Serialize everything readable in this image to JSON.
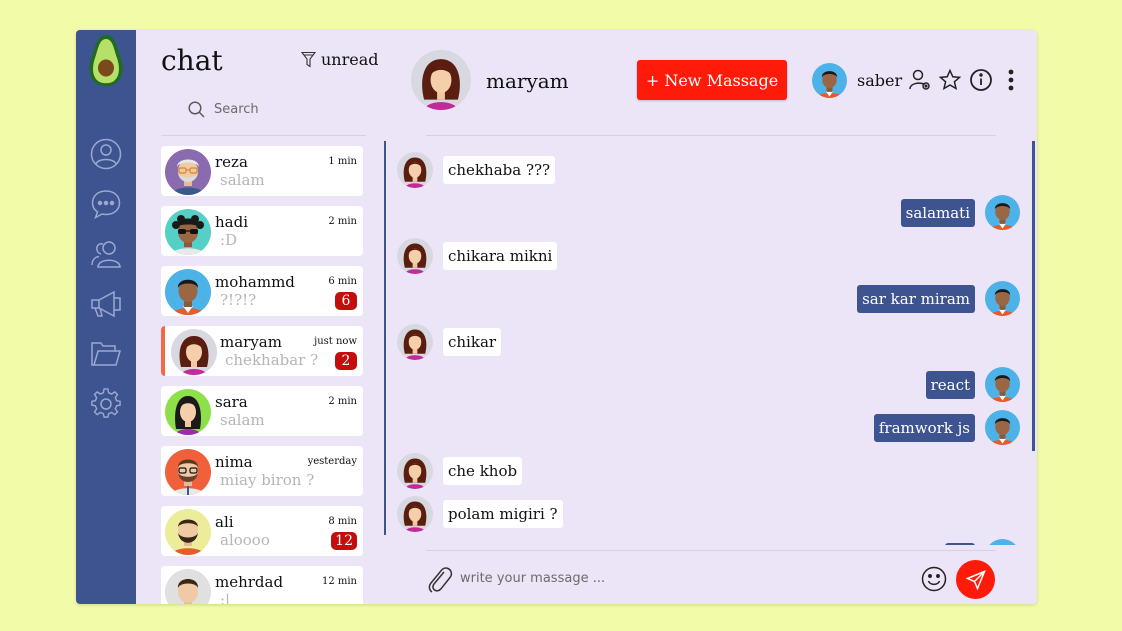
{
  "sidebar": {
    "icons": [
      "profile-icon",
      "chat-bubble-icon",
      "contacts-icon",
      "megaphone-icon",
      "folder-icon",
      "settings-icon"
    ]
  },
  "list": {
    "title": "chat",
    "filter_label": "unread",
    "search_placeholder": "Search",
    "chats": [
      {
        "name": "reza",
        "preview": "salam",
        "time": "1 min",
        "badge": ""
      },
      {
        "name": "hadi",
        "preview": ":D",
        "time": "2 min",
        "badge": ""
      },
      {
        "name": "mohammd",
        "preview": "?!?!?",
        "time": "6 min",
        "badge": "6"
      },
      {
        "name": "maryam",
        "preview": "chekhabar ?",
        "time": "just now",
        "badge": "2"
      },
      {
        "name": "sara",
        "preview": "salam",
        "time": "2 min",
        "badge": ""
      },
      {
        "name": "nima",
        "preview": "miay biron ?",
        "time": "yesterday",
        "badge": ""
      },
      {
        "name": "ali",
        "preview": "aloooo",
        "time": "8 min",
        "badge": "12"
      },
      {
        "name": "mehrdad",
        "preview": ":|",
        "time": "12 min",
        "badge": ""
      }
    ]
  },
  "header": {
    "contact_name": "maryam",
    "new_button": "+ New Massage",
    "user_name": "saber"
  },
  "messages": [
    {
      "dir": "in",
      "text": "chekhaba ???"
    },
    {
      "dir": "out",
      "text": "salamati"
    },
    {
      "dir": "in",
      "text": "chikara mikni"
    },
    {
      "dir": "out",
      "text": "sar kar miram"
    },
    {
      "dir": "in",
      "text": "chikar"
    },
    {
      "dir": "out",
      "text": "react"
    },
    {
      "dir": "out",
      "text": "framwork js"
    },
    {
      "dir": "in",
      "text": "che khob"
    },
    {
      "dir": "in",
      "text": "polam migiri ?"
    }
  ],
  "composer": {
    "placeholder": "write your massage ..."
  },
  "colors": {
    "background": "#f1fba8",
    "sidebar": "#3e5490",
    "panel": "#ece4f7",
    "accent": "#ff1a0a",
    "badge": "#c40d0d",
    "outgoing_bubble": "#3e5490"
  }
}
